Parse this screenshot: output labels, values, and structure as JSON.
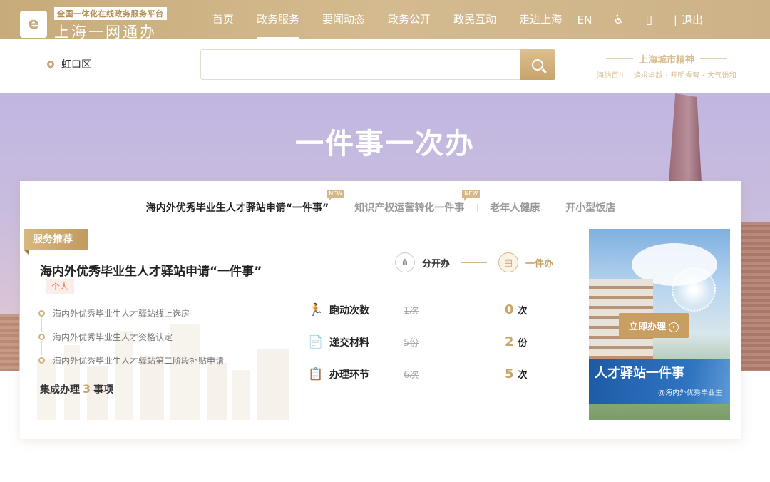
{
  "header": {
    "logo_sub": "全国一体化在线政务服务平台",
    "logo_main": "上海一网通办",
    "nav": [
      "首页",
      "政务服务",
      "要闻动态",
      "政务公开",
      "政民互动",
      "走进上海"
    ],
    "active_nav": "政务服务",
    "lang": "EN",
    "accessibility_icon": "♿",
    "mobile_icon": "▯",
    "logout": "退出",
    "logout_separator": "|"
  },
  "search": {
    "district": "虹口区",
    "placeholder": "",
    "value": ""
  },
  "spirit": {
    "title": "上海城市精神",
    "subtitle": "海纳百川 · 追求卓越 · 开明睿智 · 大气谦和"
  },
  "banner": {
    "title": "一件事一次办"
  },
  "tabs": [
    {
      "label": "海内外优秀毕业生人才驿站申请“一件事”",
      "new": "NEW",
      "active": true
    },
    {
      "label": "知识产权运营转化一件事",
      "new": "NEW",
      "active": false
    },
    {
      "label": "老年人健康",
      "new": "",
      "active": false
    },
    {
      "label": "开小型饭店",
      "new": "",
      "active": false
    }
  ],
  "service": {
    "ribbon": "服务推荐",
    "title": "海内外优秀毕业生人才驿站申请“一件事”",
    "tag": "个人",
    "steps": [
      "海内外优秀毕业生人才驿站线上选房",
      "海内外优秀毕业生人才资格认定",
      "海内外优秀毕业生人才驿站第二阶段补贴申请"
    ],
    "summary_prefix": "集成办理",
    "summary_count": "3",
    "summary_suffix": "事项"
  },
  "mode": {
    "before": "分开办",
    "after": "一件办"
  },
  "metrics": [
    {
      "icon": "🏃",
      "label": "跑动次数",
      "old": "1次",
      "new": "0",
      "unit": "次"
    },
    {
      "icon": "📄",
      "label": "递交材料",
      "old": "5份",
      "new": "2",
      "unit": "份"
    },
    {
      "icon": "📋",
      "label": "办理环节",
      "old": "6次",
      "new": "5",
      "unit": "次"
    }
  ],
  "promo": {
    "button": "立即办理",
    "title": "人才驿站一件事",
    "subtitle": "@海内外优秀毕业生"
  },
  "colors": {
    "brand_gold": "#c7ab7a",
    "accent_gold": "#c9a56b",
    "banner_purple": "#c1b6e0"
  }
}
